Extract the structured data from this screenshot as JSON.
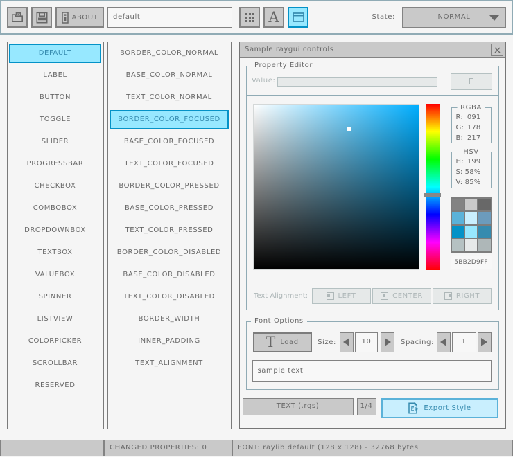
{
  "toolbar": {
    "about_label": "ABOUT",
    "style_name_value": "default",
    "state_label": "State:",
    "state_value": "NORMAL"
  },
  "controls_list": {
    "items": [
      "DEFAULT",
      "LABEL",
      "BUTTON",
      "TOGGLE",
      "SLIDER",
      "PROGRESSBAR",
      "CHECKBOX",
      "COMBOBOX",
      "DROPDOWNBOX",
      "TEXTBOX",
      "VALUEBOX",
      "SPINNER",
      "LISTVIEW",
      "COLORPICKER",
      "SCROLLBAR",
      "RESERVED"
    ],
    "selected_index": 0
  },
  "properties_list": {
    "items": [
      "BORDER_COLOR_NORMAL",
      "BASE_COLOR_NORMAL",
      "TEXT_COLOR_NORMAL",
      "BORDER_COLOR_FOCUSED",
      "BASE_COLOR_FOCUSED",
      "TEXT_COLOR_FOCUSED",
      "BORDER_COLOR_PRESSED",
      "BASE_COLOR_PRESSED",
      "TEXT_COLOR_PRESSED",
      "BORDER_COLOR_DISABLED",
      "BASE_COLOR_DISABLED",
      "TEXT_COLOR_DISABLED",
      "BORDER_WIDTH",
      "INNER_PADDING",
      "TEXT_ALIGNMENT"
    ],
    "selected_index": 3
  },
  "window": {
    "title": "Sample raygui controls"
  },
  "property_editor": {
    "group_label": "Property Editor",
    "value_label": "Value:",
    "value_text": "",
    "rgba_group_label": "RGBA",
    "rgba_rows": [
      {
        "label": "R:",
        "value": "091"
      },
      {
        "label": "G:",
        "value": "178"
      },
      {
        "label": "B:",
        "value": "217"
      }
    ],
    "hsv_group_label": "HSV",
    "hsv_rows": [
      {
        "label": "H:",
        "value": "199"
      },
      {
        "label": "S:",
        "value": "58%"
      },
      {
        "label": "V:",
        "value": "85%"
      }
    ],
    "picker": {
      "hue": 199,
      "saturation_pct": 58,
      "value_pct": 85
    },
    "palette": [
      "#838383",
      "#c9c9c9",
      "#686868",
      "#5bb2d9",
      "#c9effe",
      "#6c9bbc",
      "#0492c7",
      "#97e8ff",
      "#368baf",
      "#b5c1c2",
      "#e6e9e9",
      "#aeb7b8"
    ],
    "hex_value": "5BB2D9FF",
    "text_alignment_label": "Text Alignment:",
    "alignment_options": [
      "LEFT",
      "CENTER",
      "RIGHT"
    ]
  },
  "font_options": {
    "group_label": "Font Options",
    "load_label": "Load",
    "load_t_glyph": "T",
    "size_label": "Size:",
    "size_value": "10",
    "spacing_label": "Spacing:",
    "spacing_value": "1",
    "sample_text": "sample text"
  },
  "footer_buttons": {
    "export_format": "TEXT (.rgs)",
    "page_indicator": "1/4",
    "export_label": "Export Style"
  },
  "status_bar": {
    "changed_properties": "CHANGED PROPERTIES: 0",
    "font_info": "FONT: raylib default (128 x 128) - 32768 bytes"
  },
  "colors": {
    "background": "#f5f5f5",
    "panel_line": "#90abb5",
    "border_normal": "#838383",
    "base_normal": "#c9c9c9",
    "text_normal": "#686868",
    "border_pressed": "#0492c7",
    "base_pressed": "#97e8ff",
    "text_pressed": "#368baf",
    "border_focused": "#5bb2d9",
    "base_focused": "#c9effe",
    "border_disabled": "#b5c1c2",
    "base_disabled": "#e6e9e9",
    "text_disabled": "#aeb7b8"
  }
}
